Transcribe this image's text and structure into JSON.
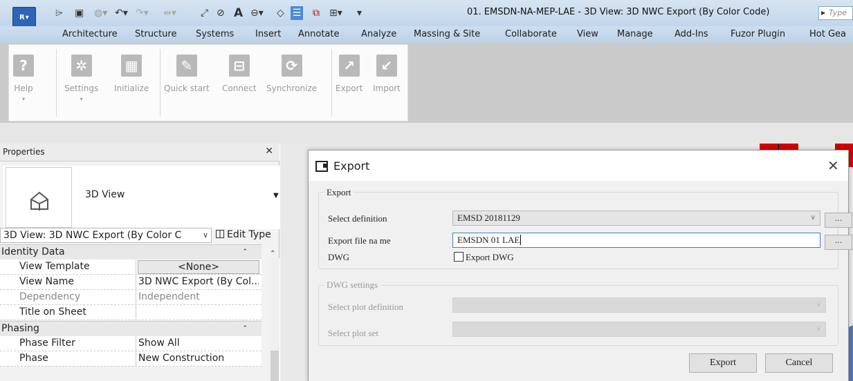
{
  "app": {
    "logo": "R",
    "window_title": "01. EMSDN-NA-MEP-LAE - 3D View: 3D NWC Export (By Color Code)",
    "type_placeholder": "Type"
  },
  "ribbon_tabs": [
    "Architecture",
    "Structure",
    "Systems",
    "Insert",
    "Annotate",
    "Analyze",
    "Massing & Site",
    "Collaborate",
    "View",
    "Manage",
    "Add-Ins",
    "Fuzor Plugin",
    "Hot Gea"
  ],
  "ribbon_buttons": [
    {
      "label": "Help",
      "icon": "help-icon"
    },
    {
      "label": "Settings",
      "icon": "gear-icon"
    },
    {
      "label": "Initialize",
      "icon": "calculator-icon"
    },
    {
      "label": "Quick start",
      "icon": "edit-icon"
    },
    {
      "label": "Connect",
      "icon": "tree-icon"
    },
    {
      "label": "Synchronize",
      "icon": "sync-icon"
    },
    {
      "label": "Export",
      "icon": "export-icon"
    },
    {
      "label": "Import",
      "icon": "import-icon"
    }
  ],
  "properties": {
    "title": "Properties",
    "type_name": "3D View",
    "type_selector": "3D View: 3D NWC Export (By Color C",
    "edit_type": "Edit Type",
    "groups": [
      {
        "name": "Identity Data",
        "rows": [
          {
            "key": "View Template",
            "value": "<None>"
          },
          {
            "key": "View Name",
            "value": "3D NWC Export (By Col..."
          },
          {
            "key": "Dependency",
            "value": "Independent"
          },
          {
            "key": "Title on Sheet",
            "value": ""
          }
        ]
      },
      {
        "name": "Phasing",
        "rows": [
          {
            "key": "Phase Filter",
            "value": "Show All"
          },
          {
            "key": "Phase",
            "value": "New Construction"
          }
        ]
      }
    ]
  },
  "dialog": {
    "title": "Export",
    "group_export": "Export",
    "select_definition_label": "Select definition",
    "select_definition_value": "EMSD 20181129",
    "file_name_label": "Export file na me",
    "file_name_value": "EMSDN 01 LAE",
    "dwg_label": "DWG",
    "export_dwg_label": "Export DWG",
    "dots": "...",
    "group_dwg": "DWG settings",
    "plot_definition_label": "Select plot definition",
    "plot_set_label": "Select plot set",
    "export_button": "Export",
    "cancel_button": "Cancel"
  }
}
